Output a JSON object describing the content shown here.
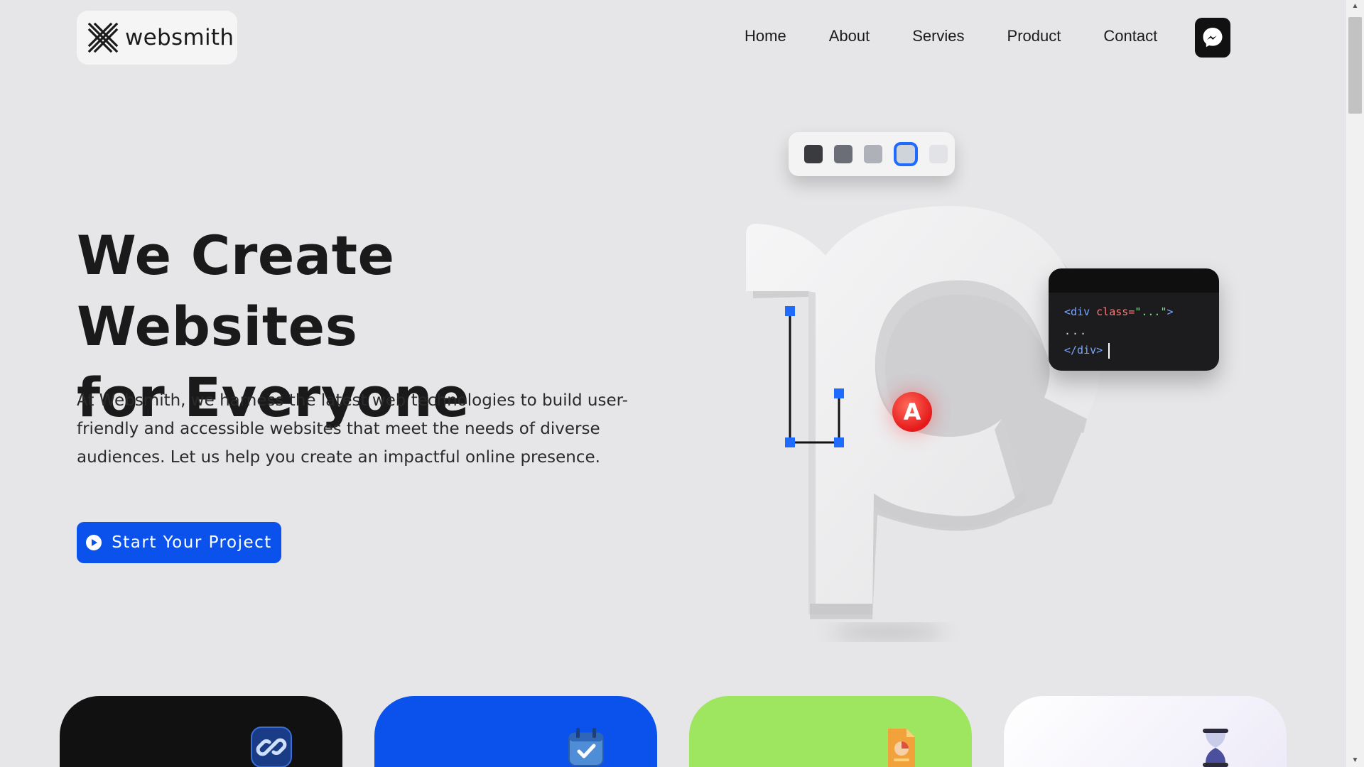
{
  "header": {
    "logo_text": "websmith",
    "nav": [
      "Home",
      "About",
      "Servies",
      "Product",
      "Contact"
    ],
    "messenger_icon": "messenger-icon"
  },
  "hero": {
    "title_line1": "We Create Websites",
    "title_line2": "for Everyone",
    "description": "At Websmith, we harness the latest web technologies to build user-friendly and accessible websites that meet the needs of diverse audiences. Let us help you create an impactful online presence.",
    "cta_label": "Start Your Project"
  },
  "illustration": {
    "palette_colors": [
      "#3a3b3e",
      "#6b6e76",
      "#aeb1b8",
      "#cfd3da",
      "#e2e3e6"
    ],
    "selected_swatch": 3,
    "code": {
      "line1_tag_open": "<div ",
      "line1_attr": "class=",
      "line1_value": "\"...\"",
      "line1_tag_close": ">",
      "line2": "...",
      "line3": "</div>"
    },
    "badge_letter": "A"
  },
  "cards": [
    {
      "color": "#111111",
      "icon": "link-icon"
    },
    {
      "color": "#0a52eb",
      "icon": "calendar-check-icon"
    },
    {
      "color": "#9ee65f",
      "icon": "document-chart-icon"
    },
    {
      "color": "#f4f3f8",
      "icon": "hourglass-icon"
    }
  ],
  "colors": {
    "accent": "#0a52eb",
    "background": "#e6e6e8"
  }
}
